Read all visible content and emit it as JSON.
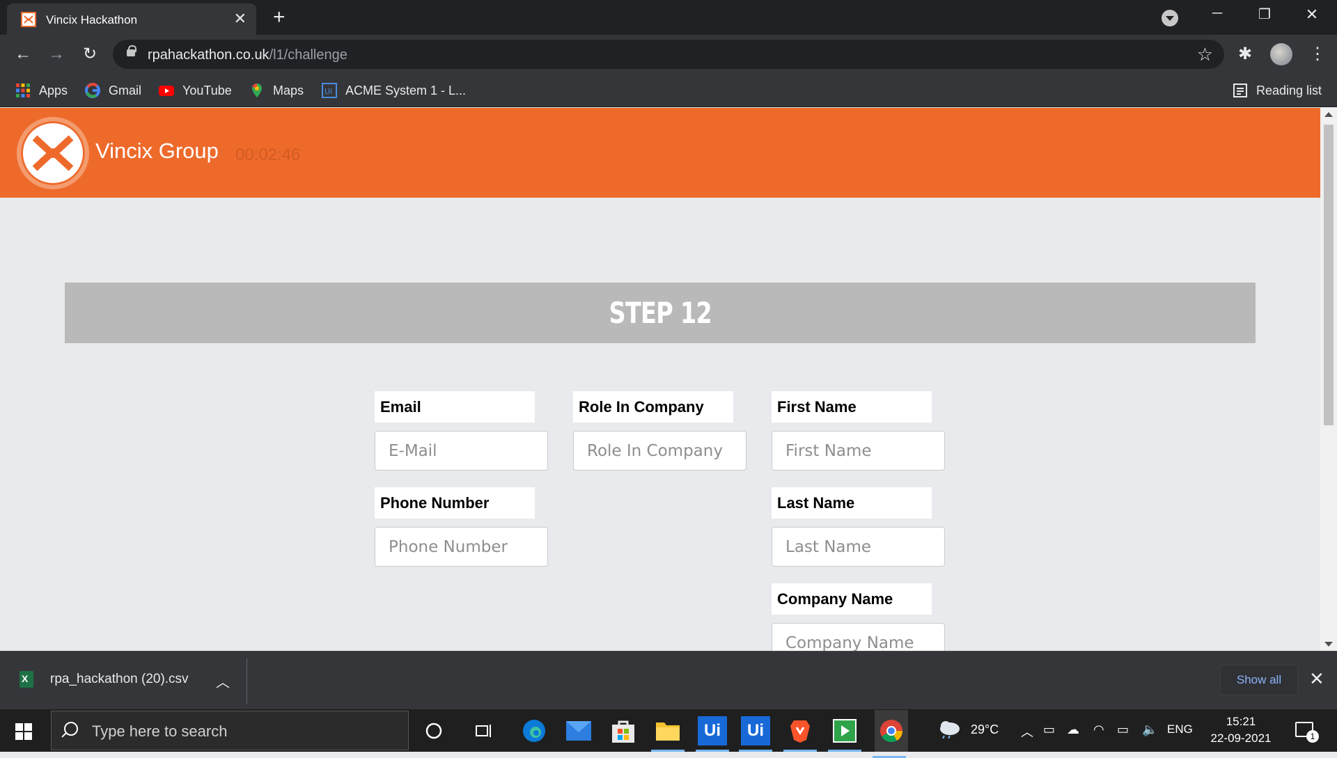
{
  "browser": {
    "tab_title": "Vincix Hackathon",
    "url_host": "rpahackathon.co.uk",
    "url_path": "/l1/challenge",
    "bookmarks": [
      {
        "label": "Apps",
        "icon": "apps-grid-icon"
      },
      {
        "label": "Gmail",
        "icon": "google-icon"
      },
      {
        "label": "YouTube",
        "icon": "youtube-icon"
      },
      {
        "label": "Maps",
        "icon": "maps-pin-icon"
      },
      {
        "label": "ACME System 1 - L...",
        "icon": "uipath-icon"
      }
    ],
    "reading_list": "Reading list"
  },
  "header": {
    "brand": "Vincix Group",
    "timer": "00:02:46",
    "color": "#ee6a2b"
  },
  "step": {
    "title": "STEP 12"
  },
  "form": {
    "email": {
      "label": "Email",
      "placeholder": "E-Mail"
    },
    "role": {
      "label": "Role In Company",
      "placeholder": "Role In Company"
    },
    "first_name": {
      "label": "First Name",
      "placeholder": "First Name"
    },
    "phone": {
      "label": "Phone Number",
      "placeholder": "Phone Number"
    },
    "last_name": {
      "label": "Last Name",
      "placeholder": "Last Name"
    },
    "company": {
      "label": "Company Name",
      "placeholder": "Company Name"
    }
  },
  "downloads": {
    "file": "rpa_hackathon (20).csv",
    "show_all": "Show all"
  },
  "taskbar": {
    "search_placeholder": "Type here to search",
    "weather": "29°C",
    "language": "ENG",
    "time": "15:21",
    "date": "22-09-2021",
    "notifications": "1"
  }
}
